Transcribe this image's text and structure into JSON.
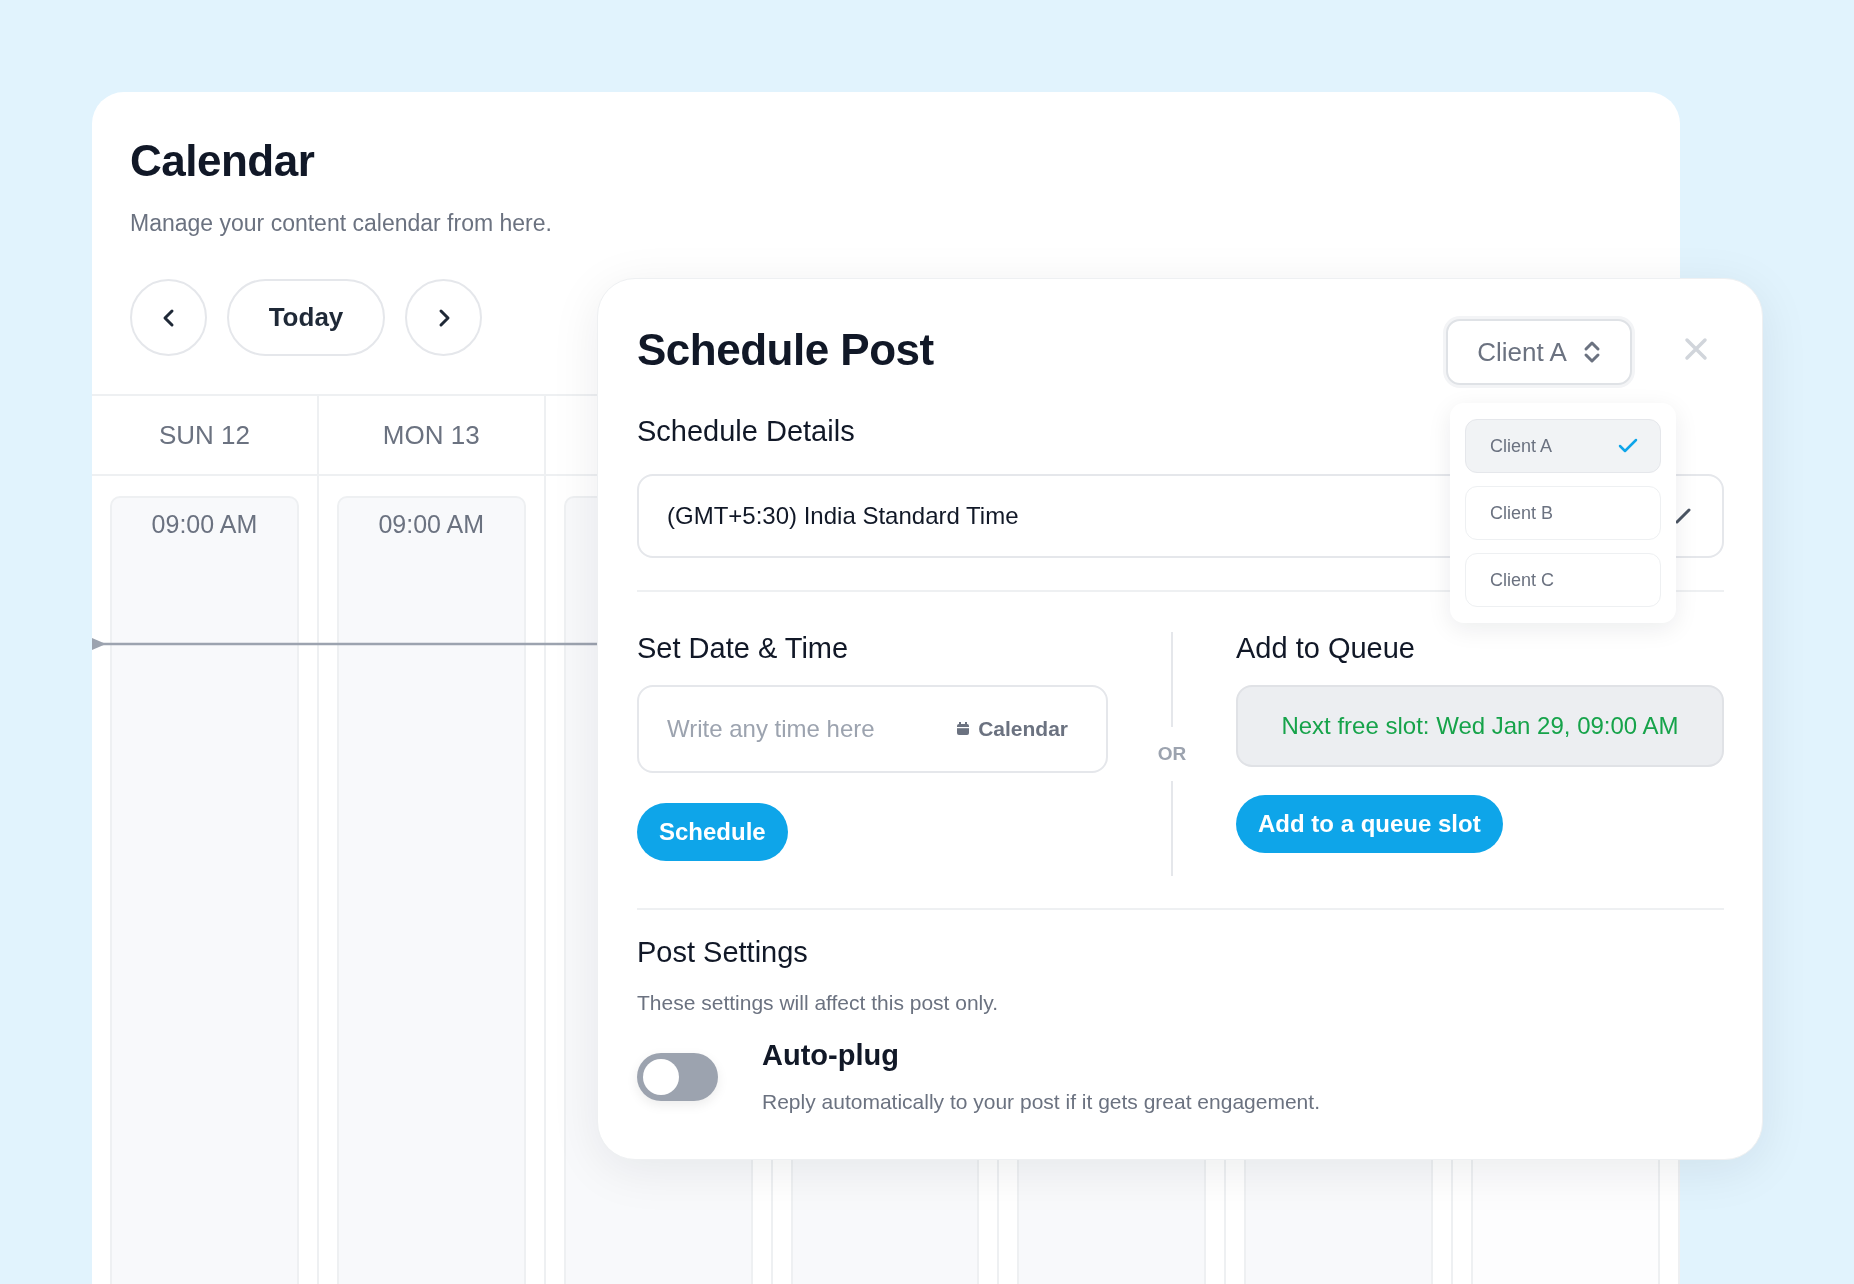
{
  "page": {
    "title": "Calendar",
    "subtitle": "Manage your content calendar from here."
  },
  "nav": {
    "today": "Today"
  },
  "days": [
    {
      "label": "SUN 12",
      "slot": "09:00 AM"
    },
    {
      "label": "MON 13",
      "slot": "09:00 AM"
    }
  ],
  "modal": {
    "title": "Schedule Post",
    "client_select": {
      "value": "Client A",
      "expanded": true,
      "options": [
        {
          "label": "Client A",
          "selected": true
        },
        {
          "label": "Client B",
          "selected": false
        },
        {
          "label": "Client C",
          "selected": false
        }
      ]
    },
    "schedule_details": {
      "heading": "Schedule Details",
      "timezone": "(GMT+5:30) India Standard Time"
    },
    "date_time": {
      "heading": "Set Date & Time",
      "placeholder": "Write any time here",
      "calendar_button": "Calendar",
      "schedule_button": "Schedule"
    },
    "separator": "OR",
    "queue": {
      "heading": "Add to Queue",
      "next_slot": "Next free slot: Wed Jan 29, 09:00 AM",
      "button": "Add to a queue slot"
    },
    "post_settings": {
      "heading": "Post Settings",
      "description": "These settings will affect this post only.",
      "settings": [
        {
          "label": "Auto-plug",
          "description": "Reply automatically to your post if it gets great engagement.",
          "on": false
        }
      ]
    }
  }
}
